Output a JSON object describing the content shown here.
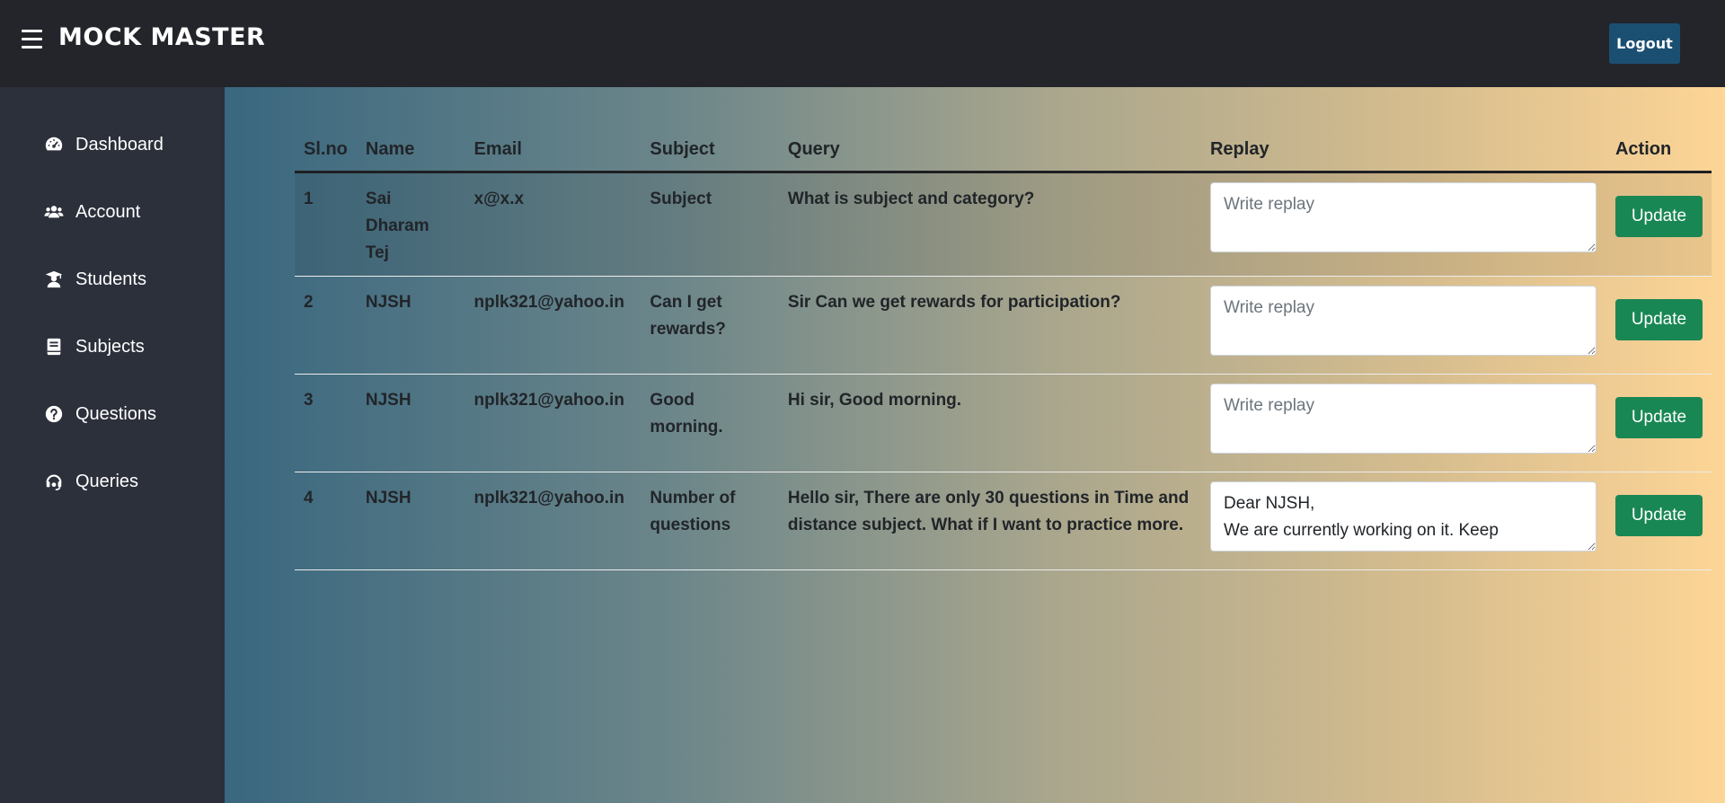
{
  "header": {
    "brand": "MOCK MASTER",
    "menu_icon": "hamburger-menu-icon",
    "logout_label": "Logout"
  },
  "sidebar": {
    "items": [
      {
        "label": "Dashboard",
        "icon": "speedometer-icon"
      },
      {
        "label": "Account",
        "icon": "users-icon"
      },
      {
        "label": "Students",
        "icon": "graduate-icon"
      },
      {
        "label": "Subjects",
        "icon": "book-icon"
      },
      {
        "label": "Questions",
        "icon": "question-circle-icon"
      },
      {
        "label": "Queries",
        "icon": "headset-icon"
      }
    ]
  },
  "table": {
    "headers": [
      "Sl.no",
      "Name",
      "Email",
      "Subject",
      "Query",
      "Replay",
      "Action"
    ],
    "reply_placeholder": "Write replay",
    "update_label": "Update",
    "rows": [
      {
        "slno": "1",
        "name": "Sai Dharam Tej",
        "email": "x@x.x",
        "subject": "Subject",
        "query": "What is subject and category?",
        "reply": ""
      },
      {
        "slno": "2",
        "name": "NJSH",
        "email": "nplk321@yahoo.in",
        "subject": "Can I get rewards?",
        "query": "Sir Can we get rewards for participation?",
        "reply": ""
      },
      {
        "slno": "3",
        "name": "NJSH",
        "email": "nplk321@yahoo.in",
        "subject": "Good morning.",
        "query": "Hi sir, Good morning.",
        "reply": ""
      },
      {
        "slno": "4",
        "name": "NJSH",
        "email": "nplk321@yahoo.in",
        "subject": "Number of questions",
        "query": "Hello sir, There are only 30 questions in Time and distance subject. What if I want to practice more.",
        "reply": "Dear NJSH,\nWe are currently working on it. Keep"
      }
    ]
  },
  "colors": {
    "topbar": "#23252b",
    "sidebar": "#2c303b",
    "logout_button": "#1b4f72",
    "update_button": "#198754",
    "gradient_start": "#39677f",
    "gradient_end": "#fdd596"
  }
}
